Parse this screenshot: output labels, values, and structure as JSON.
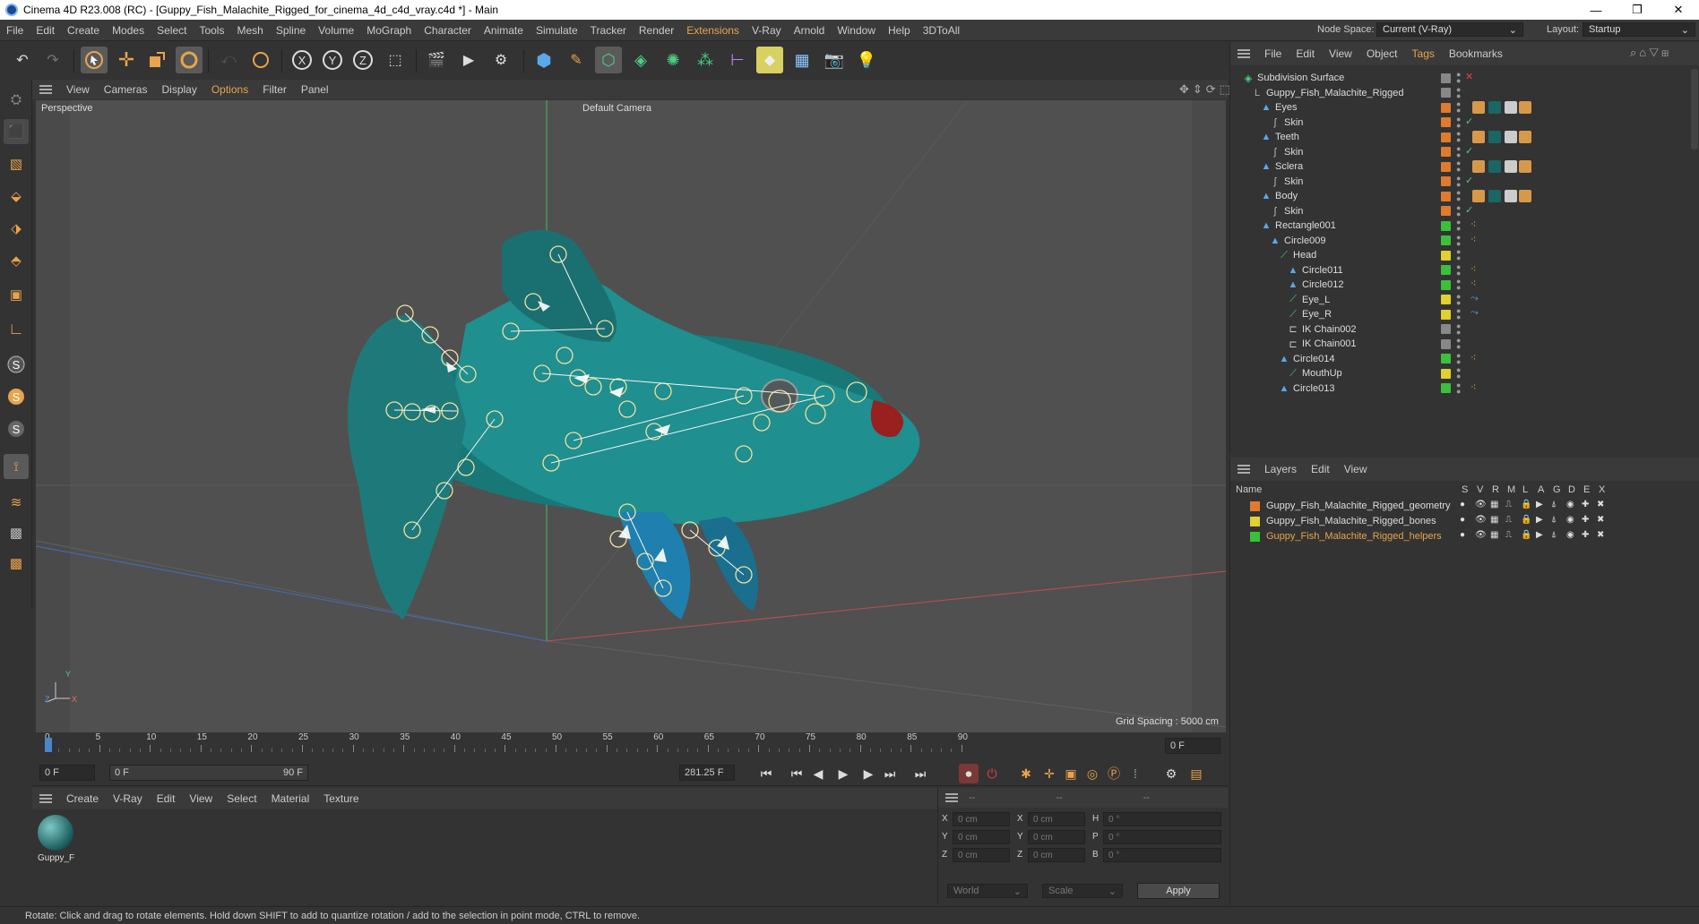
{
  "window": {
    "title": "Cinema 4D R23.008 (RC) - [Guppy_Fish_Malachite_Rigged_for_cinema_4d_c4d_vray.c4d *] - Main"
  },
  "menubar": {
    "items": [
      "File",
      "Edit",
      "Create",
      "Modes",
      "Select",
      "Tools",
      "Mesh",
      "Spline",
      "Volume",
      "MoGraph",
      "Character",
      "Animate",
      "Simulate",
      "Tracker",
      "Render",
      "Extensions",
      "V-Ray",
      "Arnold",
      "Window",
      "Help",
      "3DToAll"
    ],
    "node_space_label": "Node Space:",
    "node_space_value": "Current (V-Ray)",
    "layout_label": "Layout:",
    "layout_value": "Startup"
  },
  "viewport": {
    "menu": [
      "View",
      "Cameras",
      "Display",
      "Options",
      "Filter",
      "Panel"
    ],
    "view_name": "Perspective",
    "camera": "Default Camera",
    "grid_spacing": "Grid Spacing : 5000 cm",
    "axis_labels": {
      "y": "Y",
      "z": "Z",
      "x": "X"
    }
  },
  "timeline": {
    "ticks": [
      "0",
      "5",
      "10",
      "15",
      "20",
      "25",
      "30",
      "35",
      "40",
      "45",
      "50",
      "55",
      "60",
      "65",
      "70",
      "75",
      "80",
      "85",
      "90"
    ],
    "current_frame_field": "0 F",
    "start_field": "0 F",
    "range_start": "0 F",
    "range_end": "90 F",
    "fps_field": "281.25 F"
  },
  "material_manager": {
    "menu": [
      "Create",
      "V-Ray",
      "Edit",
      "View",
      "Select",
      "Material",
      "Texture"
    ],
    "materials": [
      {
        "name": "Guppy_F"
      }
    ]
  },
  "attributes": {
    "header": [
      "--",
      "--",
      "--"
    ],
    "rows": [
      {
        "l1": "X",
        "v1": "0 cm",
        "l2": "X",
        "v2": "0 cm",
        "l3": "H",
        "v3": "0 °"
      },
      {
        "l1": "Y",
        "v1": "0 cm",
        "l2": "Y",
        "v2": "0 cm",
        "l3": "P",
        "v3": "0 °"
      },
      {
        "l1": "Z",
        "v1": "0 cm",
        "l2": "Z",
        "v2": "0 cm",
        "l3": "B",
        "v3": "0 °"
      }
    ],
    "coord_mode": "World",
    "scale_mode": "Scale",
    "apply_label": "Apply"
  },
  "object_manager": {
    "menu": [
      "File",
      "Edit",
      "View",
      "Object",
      "Tags",
      "Bookmarks"
    ],
    "objects": [
      {
        "name": "Subdivision Surface",
        "color": "#888888",
        "tags": "x"
      },
      {
        "name": "Guppy_Fish_Malachite_Rigged",
        "color": "#888888",
        "tags": ""
      },
      {
        "name": "Eyes",
        "color": "#e07a2e",
        "tags": "mat"
      },
      {
        "name": "Skin",
        "color": "#e07a2e",
        "tags": "check"
      },
      {
        "name": "Teeth",
        "color": "#e07a2e",
        "tags": "mat"
      },
      {
        "name": "Skin",
        "color": "#e07a2e",
        "tags": "check"
      },
      {
        "name": "Sclera",
        "color": "#e07a2e",
        "tags": "mat"
      },
      {
        "name": "Skin",
        "color": "#e07a2e",
        "tags": "check"
      },
      {
        "name": "Body",
        "color": "#e07a2e",
        "tags": "mat"
      },
      {
        "name": "Skin",
        "color": "#e07a2e",
        "tags": "check"
      },
      {
        "name": "Rectangle001",
        "color": "#3cc03c",
        "tags": "dot"
      },
      {
        "name": "Circle009",
        "color": "#3cc03c",
        "tags": "dot"
      },
      {
        "name": "Head",
        "color": "#e0d030",
        "tags": ""
      },
      {
        "name": "Circle011",
        "color": "#3cc03c",
        "tags": "dot"
      },
      {
        "name": "Circle012",
        "color": "#3cc03c",
        "tags": "dot"
      },
      {
        "name": "Eye_L",
        "color": "#e0d030",
        "tags": "ik"
      },
      {
        "name": "Eye_R",
        "color": "#e0d030",
        "tags": "ik"
      },
      {
        "name": "IK Chain002",
        "color": "#888888",
        "tags": ""
      },
      {
        "name": "IK Chain001",
        "color": "#888888",
        "tags": ""
      },
      {
        "name": "Circle014",
        "color": "#3cc03c",
        "tags": "dot"
      },
      {
        "name": "MouthUp",
        "color": "#e0d030",
        "tags": ""
      },
      {
        "name": "Circle013",
        "color": "#3cc03c",
        "tags": "dot"
      }
    ]
  },
  "layer_manager": {
    "menu": [
      "Layers",
      "Edit",
      "View"
    ],
    "header_name": "Name",
    "columns": [
      "S",
      "V",
      "R",
      "M",
      "L",
      "A",
      "G",
      "D",
      "E",
      "X"
    ],
    "layers": [
      {
        "name": "Guppy_Fish_Malachite_Rigged_geometry",
        "color": "#e07a2e",
        "text_color": "#dddddd"
      },
      {
        "name": "Guppy_Fish_Malachite_Rigged_bones",
        "color": "#e0d030",
        "text_color": "#dddddd"
      },
      {
        "name": "Guppy_Fish_Malachite_Rigged_helpers",
        "color": "#3cc03c",
        "text_color": "#e8a44c"
      }
    ]
  },
  "status": {
    "text": "Rotate: Click and drag to rotate elements. Hold down SHIFT to add to quantize rotation / add to the selection in point mode, CTRL to remove."
  }
}
